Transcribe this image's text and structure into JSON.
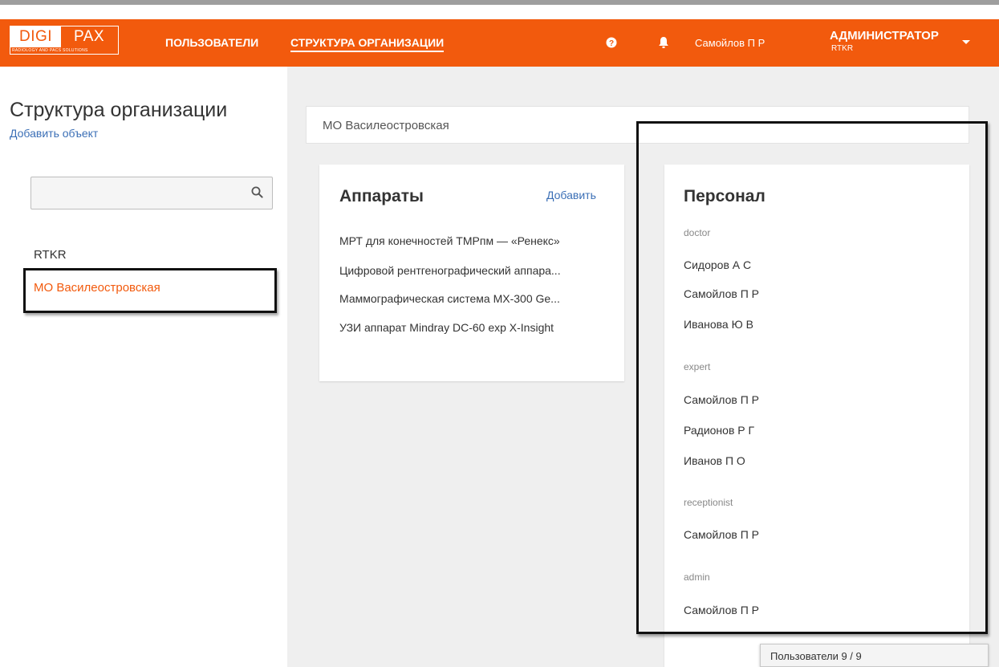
{
  "logo": {
    "part1": "DIGI",
    "part2": "PAX",
    "tagline": "RADIOLOGY AND PACS SOLUTIONS"
  },
  "nav": {
    "items": [
      {
        "label": "ПОЛЬЗОВАТЕЛИ",
        "active": false
      },
      {
        "label": "СТРУКТУРА ОРГАНИЗАЦИИ",
        "active": true
      }
    ],
    "help_icon": "question-circle-icon",
    "bell_icon": "bell-icon",
    "user_name": "Самойлов П Р",
    "role": "АДМИНИСТРАТОР",
    "org_code": "RTKR"
  },
  "colors": {
    "brand": "#f25a0d",
    "link": "#3b6fb6",
    "selected": "#f25a0d",
    "background": "#efefef"
  },
  "sidebar": {
    "title": "Структура организации",
    "add_object": "Добавить объект",
    "search": {
      "value": "",
      "placeholder": ""
    },
    "tree": [
      {
        "label": "RTKR",
        "selected": false
      },
      {
        "label": "МО Василеостровская",
        "selected": true
      }
    ]
  },
  "breadcrumb": "МО Василеостровская",
  "devices": {
    "title": "Аппараты",
    "add_label": "Добавить",
    "items": [
      "МРТ для конечностей ТМРпм — «Ренекс»",
      "Цифровой рентгенографический аппара...",
      "Маммографическая система MX-300 Ge...",
      "УЗИ аппарат Mindray DC-60 exp X-Insight"
    ]
  },
  "staff": {
    "title": "Персонал",
    "groups": [
      {
        "role": "doctor",
        "people": [
          "Сидоров А С",
          "Самойлов П Р",
          "Иванова Ю В"
        ]
      },
      {
        "role": "expert",
        "people": [
          "Самойлов П Р",
          "Радионов Р Г",
          "Иванов П О"
        ]
      },
      {
        "role": "receptionist",
        "people": [
          "Самойлов П Р"
        ]
      },
      {
        "role": "admin",
        "people": [
          "Самойлов П Р"
        ]
      }
    ]
  },
  "status": "Пользователи 9 / 9"
}
